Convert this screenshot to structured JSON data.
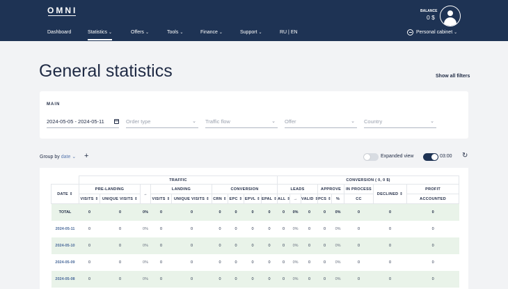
{
  "header": {
    "logo": "OMNI",
    "nav": [
      {
        "label": "Dashboard",
        "chevron": false
      },
      {
        "label": "Statistics",
        "chevron": true,
        "active": true
      },
      {
        "label": "Offers",
        "chevron": true
      },
      {
        "label": "Tools",
        "chevron": true
      },
      {
        "label": "Finance",
        "chevron": true
      },
      {
        "label": "Support",
        "chevron": true
      }
    ],
    "lang": "RU | EN",
    "balance_label": "BALANCE",
    "balance_value": "0 $",
    "cabinet_label": "Personal cabinet",
    "chevron": "⌄"
  },
  "page": {
    "title": "General statistics",
    "show_all_filters": "Show all filters"
  },
  "filters": {
    "section": "MAIN",
    "date_range": "2024-05-05 - 2024-05-11",
    "order_type": "Order type",
    "traffic_flow": "Traffic flow",
    "offer": "Offer",
    "country": "Country",
    "chevron": "⌄"
  },
  "toolbar": {
    "group_by_label": "Group by",
    "group_by_value": "date",
    "plus": "+",
    "expanded_view": "Expanded view",
    "expanded_view_on": false,
    "time": "03:00",
    "time_toggle_on": true,
    "refresh": "↻"
  },
  "table": {
    "groups": {
      "traffic": "TRAFFIC",
      "conversion": "CONVERSION ( 0, 0 $)"
    },
    "h_date": "DATE ⇕",
    "h_prelanding": "PRE-LANDING",
    "h_arrow": "→",
    "h_landing": "LANDING",
    "h_conversion": "CONVERSION",
    "h_leads": "LEADS",
    "h_approve": "APPROVE",
    "h_inprocess": "IN PROCESS",
    "h_declined": "DECLINED ⇕",
    "h_profit": "PROFIT",
    "sub": [
      "VISITS ⇕",
      "UNIQUE VISITS ⇕",
      "VISITS ⇕",
      "UNIQUE VISITS ⇕",
      "CRN ⇕",
      "EPC ⇕",
      "EPVL ⇕",
      "EPAL ⇕",
      "ALL ⇕",
      "→",
      "VALID ⇕",
      "PCS ⇕",
      "%",
      "CC",
      "ACCOUNTED"
    ],
    "rows": [
      [
        "TOTAL",
        "0",
        "0",
        "0%",
        "0",
        "0",
        "0",
        "0",
        "0",
        "0",
        "0",
        "0%",
        "0",
        "0",
        "0%",
        "0",
        "0",
        "0"
      ],
      [
        "2024-05-11",
        "0",
        "0",
        "0%",
        "0",
        "0",
        "0",
        "0",
        "0",
        "0",
        "0",
        "0%",
        "0",
        "0",
        "0%",
        "0",
        "0",
        "0"
      ],
      [
        "2024-05-10",
        "0",
        "0",
        "0%",
        "0",
        "0",
        "0",
        "0",
        "0",
        "0",
        "0",
        "0%",
        "0",
        "0",
        "0%",
        "0",
        "0",
        "0"
      ],
      [
        "2024-05-09",
        "0",
        "0",
        "0%",
        "0",
        "0",
        "0",
        "0",
        "0",
        "0",
        "0",
        "0%",
        "0",
        "0",
        "0%",
        "0",
        "0",
        "0"
      ],
      [
        "2024-05-08",
        "0",
        "0",
        "0%",
        "0",
        "0",
        "0",
        "0",
        "0",
        "0",
        "0",
        "0%",
        "0",
        "0",
        "0%",
        "0",
        "0",
        "0"
      ]
    ]
  }
}
